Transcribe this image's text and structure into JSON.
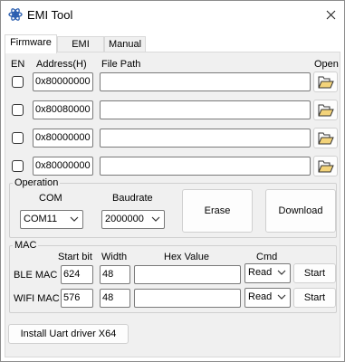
{
  "window": {
    "title": "EMI Tool"
  },
  "tabs": [
    "Firmware",
    "EMI Test",
    "Manual"
  ],
  "firmware": {
    "headers": {
      "en": "EN",
      "address": "Address(H)",
      "file_path": "File Path",
      "open": "Open"
    },
    "rows": [
      {
        "address": "0x80000000",
        "path": "",
        "enabled": false
      },
      {
        "address": "0x80080000",
        "path": "",
        "enabled": false
      },
      {
        "address": "0x80000000",
        "path": "",
        "enabled": false
      },
      {
        "address": "0x80000000",
        "path": "",
        "enabled": false
      }
    ]
  },
  "operation": {
    "title": "Operation",
    "com_label": "COM",
    "com_value": "COM11",
    "baud_label": "Baudrate",
    "baud_value": "2000000",
    "erase": "Erase",
    "download": "Download"
  },
  "mac": {
    "title": "MAC",
    "headers": {
      "start_bit": "Start bit",
      "width": "Width",
      "hex_value": "Hex Value",
      "cmd": "Cmd"
    },
    "rows": [
      {
        "label": "BLE  MAC",
        "start_bit": "624",
        "width": "48",
        "hex": "",
        "cmd": "Read",
        "action": "Start"
      },
      {
        "label": "WIFI MAC",
        "start_bit": "576",
        "width": "48",
        "hex": "",
        "cmd": "Read",
        "action": "Start"
      }
    ]
  },
  "install_driver": "Install Uart driver X64",
  "icons": {
    "app": "emi-app-icon",
    "close": "close-icon",
    "open": "open-folder-icon",
    "dropdown": "chevron-down-icon"
  }
}
